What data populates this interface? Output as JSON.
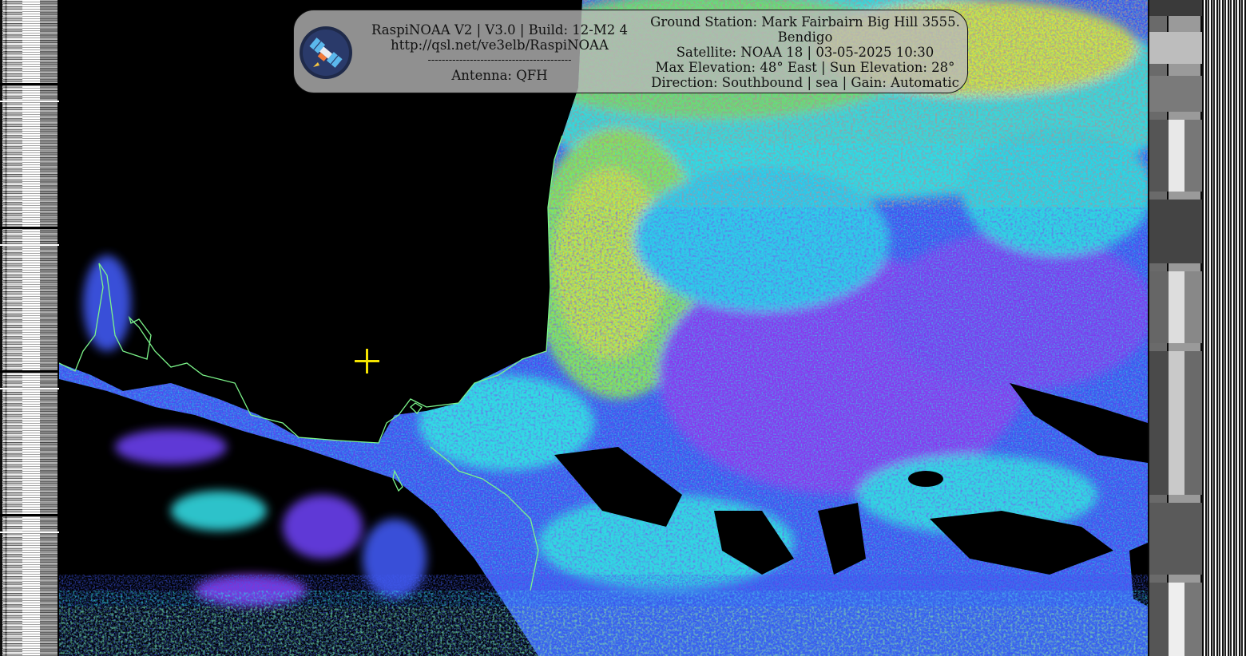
{
  "overlay": {
    "software_line": "RaspiNOAA V2 | V3.0 | Build: 12-M2 4",
    "url_line": "http://qsl.net/ve3elb/RaspiNOAA",
    "divider_line": "-----------------------------------------",
    "antenna_line": "Antenna: QFH",
    "ground_station_line1": "Ground Station: Mark Fairbairn Big Hill 3555.",
    "ground_station_line2": "Bendigo",
    "satellite_line": "Satellite: NOAA 18 | 03-05-2025 10:30",
    "elevation_line": "Max Elevation: 48° East | Sun Elevation: 28°",
    "direction_line": "Direction: Southbound | sea | Gain: Automatic"
  },
  "colors": {
    "panel_bg": "#b9b9b9",
    "crosshair": "#f5e400",
    "coastline": "#7cf58a",
    "palette_cyan": "#2fe0e6",
    "palette_blue": "#3f58f0",
    "palette_purple": "#8a3cf0",
    "palette_green": "#7ee070",
    "palette_yellow": "#e4e83a",
    "palette_orange": "#f08a28"
  },
  "icons": {
    "logo": "satellite-logo-icon",
    "crosshair": "crosshair-plus-icon"
  }
}
